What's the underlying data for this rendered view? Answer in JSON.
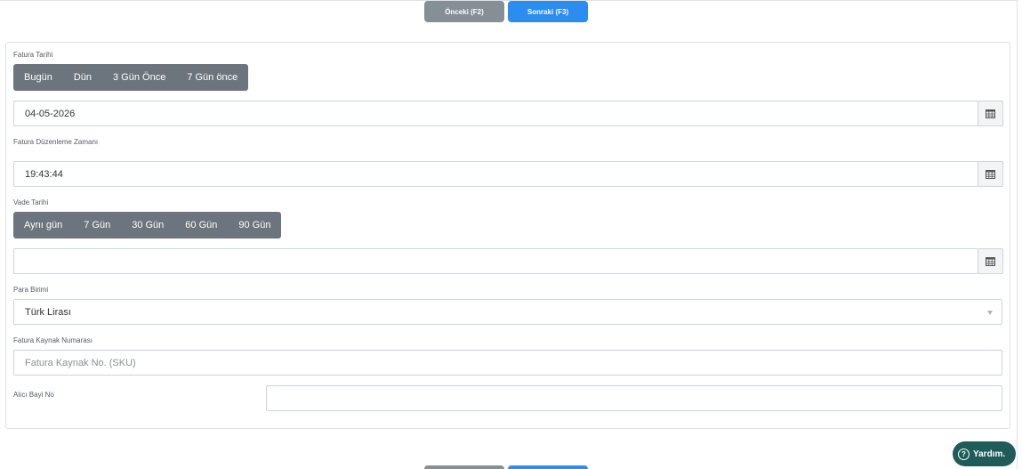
{
  "nav": {
    "prev_label": "Önceki (F2)",
    "next_label": "Sonraki (F3)"
  },
  "form": {
    "invoice_date": {
      "label": "Fatura Tarihi",
      "quick_buttons": [
        "Bugün",
        "Dün",
        "3 Gün Önce",
        "7 Gün önce"
      ],
      "value": "04-05-2026"
    },
    "invoice_time": {
      "label": "Fatura Düzenleme Zamanı",
      "value": "19:43:44"
    },
    "due_date": {
      "label": "Vade Tarihi",
      "quick_buttons": [
        "Aynı gün",
        "7 Gün",
        "30 Gün",
        "60 Gün",
        "90 Gün"
      ],
      "value": ""
    },
    "currency": {
      "label": "Para Birimi",
      "selected": "Türk Lirası"
    },
    "source_no": {
      "label": "Fatura Kaynak Numarası",
      "placeholder": "Fatura Kaynak No. (SKU)"
    },
    "buyer_dealer": {
      "label": "Alıcı Bayi No",
      "value": ""
    }
  },
  "help": {
    "label": "Yardım."
  },
  "colors": {
    "primary": "#2d8cf0",
    "secondary": "#868e96",
    "group": "#6c757d",
    "help": "#1f5c59"
  }
}
